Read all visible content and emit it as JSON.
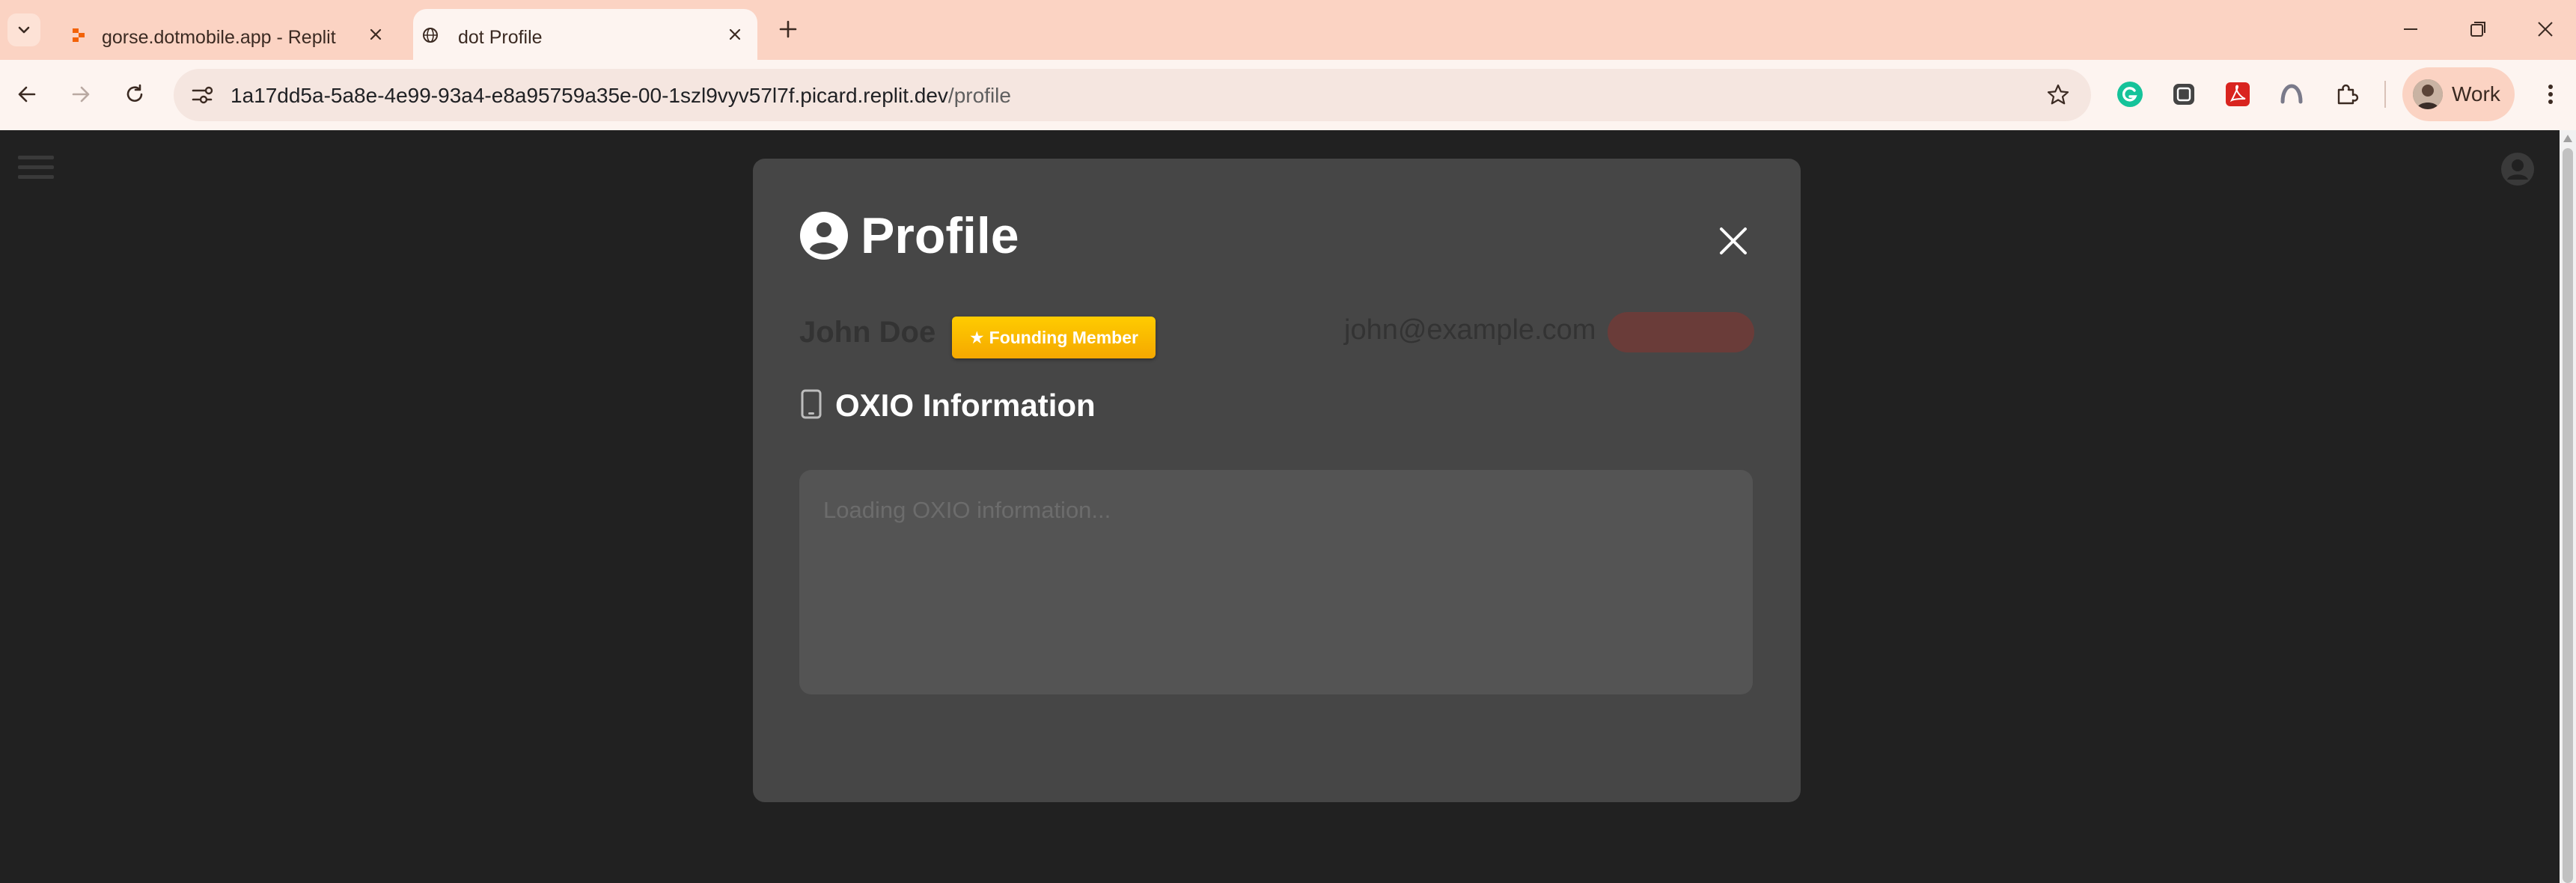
{
  "browser": {
    "tabs": [
      {
        "title": "gorse.dotmobile.app - Replit",
        "active": false
      },
      {
        "title": "dot Profile",
        "active": true
      }
    ],
    "url_host": "1a17dd5a-5a8e-4e99-93a4-e8a95759a35e-00-1szl9vyv57l7f.picard.replit.dev",
    "url_path": "/profile",
    "profile_label": "Work"
  },
  "profile_modal": {
    "title": "Profile",
    "user_name": "John Doe",
    "badge_label": "Founding Member",
    "badge_icon": "★",
    "email": "john@example.com",
    "section_title": "OXIO Information",
    "loading_text": "Loading OXIO information..."
  },
  "colors": {
    "tabstrip": "#fbd3c3",
    "toolbar": "#fdf4f0",
    "page_background": "#212121",
    "modal_background": "#464646",
    "badge": "#ffc107",
    "info_box": "#545454"
  },
  "icons": {
    "tab_search": "chevron-down-icon",
    "replit": "replit-logo-icon",
    "globe": "globe-icon",
    "profile_header": "user-circle-icon",
    "section": "mobile-phone-icon",
    "close": "close-icon"
  }
}
